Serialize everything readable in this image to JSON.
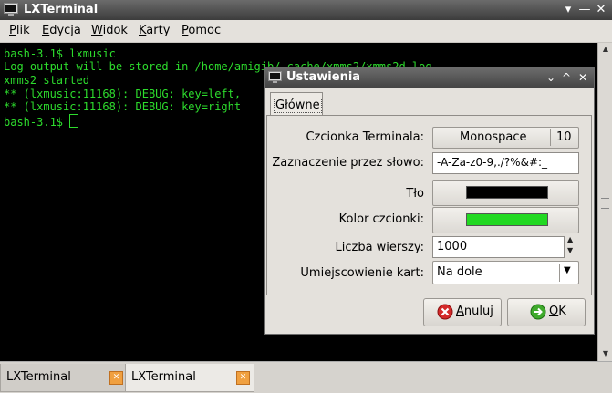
{
  "main_window": {
    "title": "LXTerminal",
    "controls": [
      "▾",
      "—",
      "✕"
    ]
  },
  "menu": [
    {
      "underline": "P",
      "rest": "lik"
    },
    {
      "underline": "E",
      "rest": "dycja"
    },
    {
      "underline": "W",
      "rest": "idok"
    },
    {
      "underline": "K",
      "rest": "arty"
    },
    {
      "underline": "P",
      "rest": "omoc"
    }
  ],
  "terminal": {
    "lines": [
      "bash-3.1$ lxmusic",
      "Log output will be stored in /home/amigib/.cache/xmms2/xmms2d.log",
      "xmms2 started",
      "** (lxmusic:11168): DEBUG: key=left, ",
      "** (lxmusic:11168): DEBUG: key=right",
      "bash-3.1$ "
    ],
    "text_color": "#2ddc2d",
    "background": "#000000"
  },
  "tabs": [
    {
      "label": "LXTerminal",
      "active": false
    },
    {
      "label": "LXTerminal",
      "active": true
    }
  ],
  "dialog": {
    "title": "Ustawienia",
    "controls": [
      "⌄",
      "^",
      "✕"
    ],
    "notebook_tab": "Główne",
    "rows": {
      "font": {
        "label": "Czcionka Terminala:",
        "name": "Monospace",
        "size": "10"
      },
      "selection": {
        "label": "Zaznaczenie przez słowo:",
        "value": "-A-Za-z0-9,./?%&#:_"
      },
      "bg": {
        "label": "Tło",
        "color": "#000000"
      },
      "fg": {
        "label": "Kolor czcionki:",
        "color": "#22d922"
      },
      "lines": {
        "label": "Liczba wierszy:",
        "value": "1000"
      },
      "tabpos": {
        "label": "Umiejscowienie kart:",
        "value": "Na dole"
      }
    },
    "buttons": {
      "cancel": {
        "underline": "A",
        "rest": "nuluj"
      },
      "ok": {
        "underline": "O",
        "rest": "K"
      }
    }
  }
}
